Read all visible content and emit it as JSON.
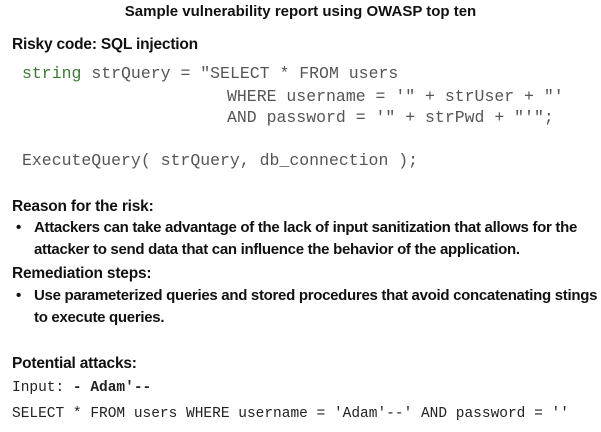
{
  "title": "Sample vulnerability report using OWASP top ten",
  "risky_code": {
    "heading": "Risky code: SQL injection",
    "line1_type": "string",
    "line1_rest": " strQuery = \"SELECT * FROM users",
    "line2": "WHERE username = '\" + strUser + \"'",
    "line3": "AND password = '\" + strPwd + \"'\";",
    "line4": "ExecuteQuery( strQuery, db_connection );"
  },
  "reason": {
    "heading": "Reason for the risk:",
    "bullet": "•",
    "text": "Attackers can take advantage of the lack of input sanitization that allows for the attacker to send data that can influence the behavior of the application."
  },
  "remediation": {
    "heading": "Remediation steps:",
    "bullet": "•",
    "text": "Use parameterized queries and stored procedures that avoid concatenating stings to execute queries."
  },
  "attacks": {
    "heading": "Potential attacks:",
    "input_label": "Input: ",
    "input_value": "- Adam'--",
    "resulting_query": "SELECT * FROM users WHERE username = 'Adam'--' AND password = ''"
  },
  "colors": {
    "keyword": "#3d7a34",
    "code_text": "#555555"
  }
}
